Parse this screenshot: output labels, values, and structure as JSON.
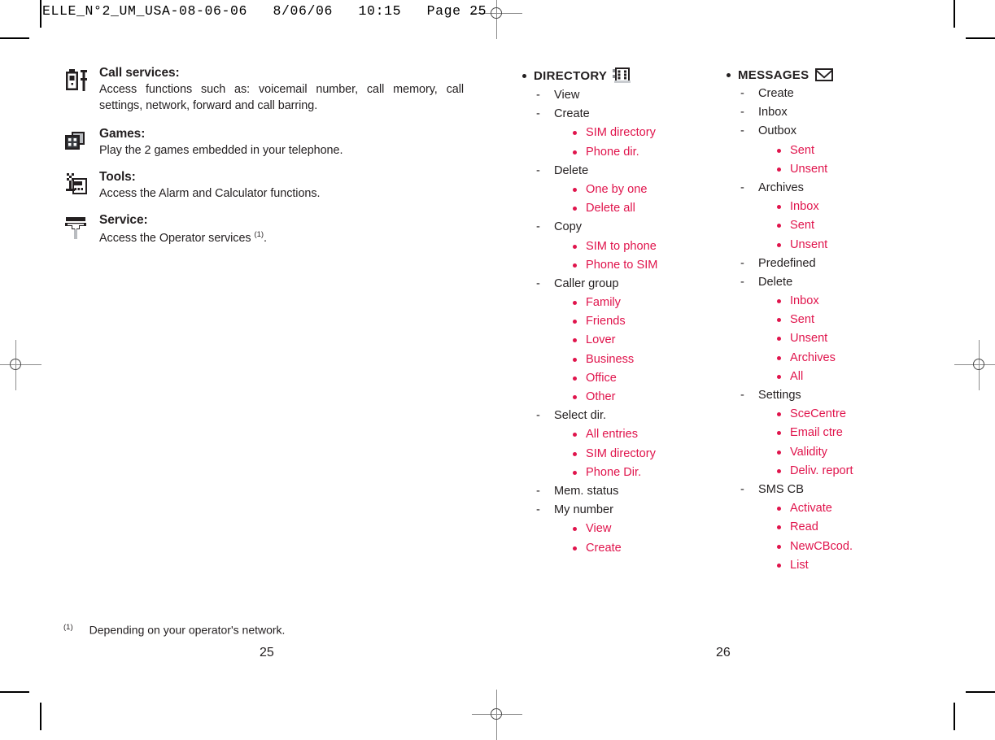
{
  "prepress": {
    "header": "ELLE_N°2_UM_USA-08-06-06   8/06/06   10:15   Page 25"
  },
  "colors": {
    "accent_red": "#e0144c",
    "text_black": "#231f20"
  },
  "page_left": {
    "folio": "25",
    "footnote_marker": "(1)",
    "footnote_text": "Depending on your operator's network.",
    "features": [
      {
        "icon": "phone-settings-icon",
        "title": "Call services:",
        "description": "Access functions such as: voicemail number, call memory, call settings, network, forward and call barring."
      },
      {
        "icon": "dice-games-icon",
        "title": "Games:",
        "description": "Play the 2 games embedded in your telephone."
      },
      {
        "icon": "tools-calculator-icon",
        "title": "Tools:",
        "description": "Access the Alarm and Calculator functions."
      },
      {
        "icon": "service-antenna-icon",
        "title": "Service:",
        "description": "Access the Operator services ",
        "footnote_ref": "(1)",
        "description_tail": "."
      }
    ]
  },
  "page_right": {
    "folio": "26"
  },
  "menus": [
    {
      "id": "directory",
      "title": "DIRECTORY",
      "icon": "directory-book-icon",
      "items": [
        {
          "label": "View",
          "children": []
        },
        {
          "label": "Create",
          "children": [
            "SIM directory",
            "Phone dir."
          ]
        },
        {
          "label": "Delete",
          "children": [
            "One by one",
            "Delete all"
          ]
        },
        {
          "label": "Copy",
          "children": [
            "SIM to phone",
            "Phone to SIM"
          ]
        },
        {
          "label": "Caller group",
          "children": [
            "Family",
            "Friends",
            "Lover",
            "Business",
            "Office",
            "Other"
          ]
        },
        {
          "label": "Select dir.",
          "children": [
            "All entries",
            "SIM directory",
            "Phone Dir."
          ]
        },
        {
          "label": "Mem. status",
          "children": []
        },
        {
          "label": "My number",
          "children": [
            "View",
            "Create"
          ]
        }
      ]
    },
    {
      "id": "messages",
      "title": "MESSAGES",
      "icon": "envelope-icon",
      "items": [
        {
          "label": "Create",
          "children": []
        },
        {
          "label": "Inbox",
          "children": []
        },
        {
          "label": "Outbox",
          "children": [
            "Sent",
            "Unsent"
          ]
        },
        {
          "label": "Archives",
          "children": [
            "Inbox",
            "Sent",
            "Unsent"
          ]
        },
        {
          "label": "Predefined",
          "children": []
        },
        {
          "label": "Delete",
          "children": [
            "Inbox",
            "Sent",
            "Unsent",
            "Archives",
            "All"
          ]
        },
        {
          "label": "Settings",
          "children": [
            "SceCentre",
            "Email ctre",
            "Validity",
            "Deliv. report"
          ]
        },
        {
          "label": "SMS CB",
          "children": [
            "Activate",
            "Read",
            "NewCBcod.",
            "List"
          ]
        }
      ]
    }
  ]
}
